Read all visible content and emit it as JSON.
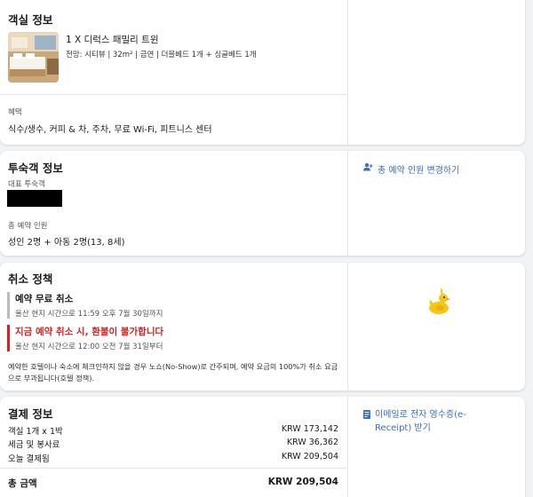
{
  "room": {
    "section_title": "객실 정보",
    "name": "1 X 디럭스 패밀리 트윈",
    "details": "전망: 시티뷰 | 32m² | 금연 | 더블베드 1개 + 싱글베드 1개",
    "benefits_label": "혜택",
    "benefits": "식수/생수, 커피 & 차, 주차, 무료 Wi-Fi, 피트니스 센터"
  },
  "guest": {
    "section_title": "투숙객 정보",
    "lead_guest_label": "대표 투숙객",
    "total_label": "총 예약 인원",
    "total_value": "성인 2명 + 아동 2명(13, 8세)",
    "change_link": "총 예약 인원 변경하기"
  },
  "cancel": {
    "section_title": "취소 정책",
    "free_title": "예약 무료 취소",
    "free_sub": "울산 현지 시간으로 11:59 오후 7월 30일까지",
    "nonref_title": "지금 예약 취소 시, 환불이 불가합니다",
    "nonref_sub": "울산 현지 시간으로 12:00 오전 7월 31일부터",
    "note": "예약한 호텔이나 숙소에 체크인하지 않을 경우 노쇼(No-Show)로 간주되며, 예약 요금의 100%가 취소 요금으로 부과됩니다(호텔 정책)."
  },
  "payment": {
    "section_title": "결제 정보",
    "rows": [
      {
        "label": "객실 1개 x 1박",
        "value": "KRW 173,142"
      },
      {
        "label": "세금 및 봉사료",
        "value": "KRW 36,362"
      },
      {
        "label": "오늘 결제됨",
        "value": "KRW 209,504"
      }
    ],
    "total_label": "총 금액",
    "total_value": "KRW 209,504",
    "receipt_link": "이메일로 전자 영수증(e-Receipt) 받기"
  },
  "colors": {
    "link": "#3b6fc4",
    "warning_red": "#d32323",
    "duck": "#f5c518"
  }
}
